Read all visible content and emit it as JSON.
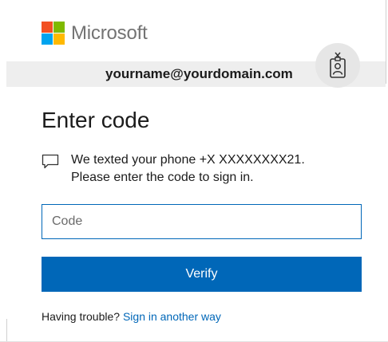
{
  "brand": {
    "name": "Microsoft",
    "colors": {
      "red": "#f25022",
      "green": "#7fba00",
      "blue": "#00a4ef",
      "yellow": "#ffb900"
    }
  },
  "identity": {
    "email": "yourname@yourdomain.com",
    "icon": "id-badge-icon"
  },
  "page": {
    "title": "Enter code"
  },
  "message": {
    "icon": "speech-bubble-icon",
    "line1": "We texted your phone +X XXXXXXXX21.",
    "line2": "Please enter the code to sign in."
  },
  "form": {
    "code_placeholder": "Code",
    "code_value": "",
    "verify_label": "Verify"
  },
  "help": {
    "prefix": "Having trouble?",
    "link_label": "Sign in another way"
  },
  "colors": {
    "accent": "#0067b8",
    "identity_bar": "#eeeeee"
  }
}
